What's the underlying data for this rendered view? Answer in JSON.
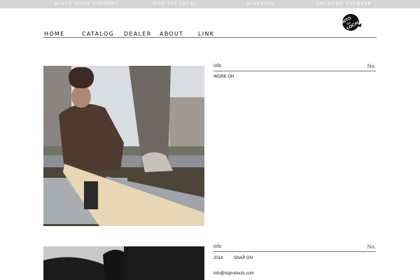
{
  "topbar": {
    "links": [
      "BLUCO WORK GARMENT",
      "INTO THE LOCAL",
      "BLUEBIRD",
      "UNCROWD EYEWEAR"
    ]
  },
  "logo": {
    "line1": "INTO",
    "line2": "the",
    "line3": "LOCAL"
  },
  "nav": {
    "items": [
      "HOME",
      "CATALOG",
      "DEALER",
      "ABOUT",
      "LINK"
    ]
  },
  "posts": [
    {
      "info_label": "info",
      "info_no": "No.",
      "title": "WORK ON"
    },
    {
      "info_label": "info",
      "info_no": "No.",
      "year": "2014",
      "title": "SNAP ON",
      "email": "info@tslproducts.com"
    }
  ],
  "colors": {
    "topbar": "#d4d4d4",
    "divider": "#777777"
  }
}
